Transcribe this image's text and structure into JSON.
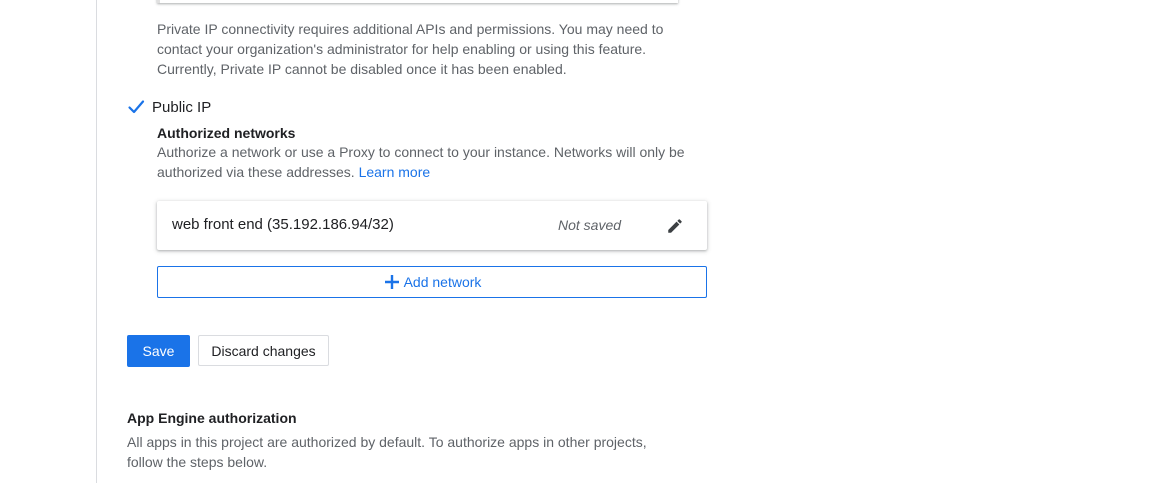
{
  "private_ip": {
    "note": "Private IP connectivity requires additional APIs and permissions. You may need to contact your organization's administrator for help enabling or using this feature. Currently, Private IP cannot be disabled once it has been enabled."
  },
  "public_ip": {
    "label": "Public IP",
    "checked": true
  },
  "authorized_networks": {
    "title": "Authorized networks",
    "description": "Authorize a network or use a Proxy to connect to your instance. Networks will only be authorized via these addresses.",
    "learn_more": "Learn more",
    "networks": [
      {
        "name": "web front end (35.192.186.94/32)",
        "status": "Not saved",
        "icon": "pencil-icon"
      }
    ],
    "add_label": "Add network",
    "add_icon": "plus-icon"
  },
  "actions": {
    "save_label": "Save",
    "discard_label": "Discard changes"
  },
  "app_engine": {
    "title": "App Engine authorization",
    "description": "All apps in this project are authorized by default. To authorize apps in other projects, follow the steps below."
  },
  "colors": {
    "accent": "#1a73e8",
    "text_primary": "#202124",
    "text_secondary": "#5f6368",
    "border": "#dadce0"
  }
}
